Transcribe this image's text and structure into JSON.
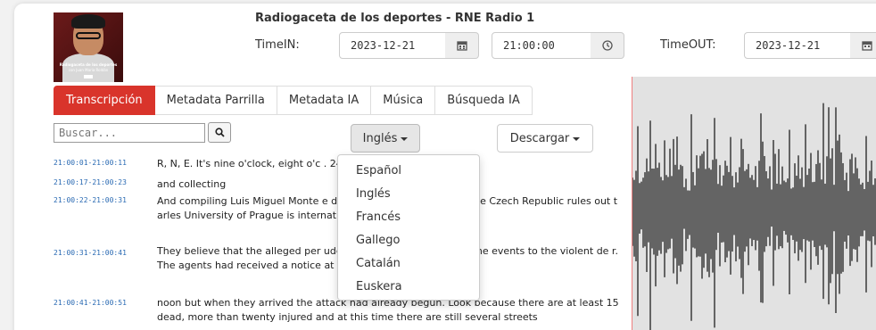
{
  "program": {
    "title": "Radiogaceta de los deportes - RNE Radio 1",
    "cover_caption_1": "Radiogaceta de los deportes",
    "cover_caption_2": "con Juan Maria Roldán"
  },
  "time_in": {
    "label": "TimeIN:",
    "date": "2023-12-21",
    "time": "21:00:00"
  },
  "time_out": {
    "label": "TimeOUT:",
    "date": "2023-12-21"
  },
  "tabs": [
    {
      "label": "Transcripción",
      "active": true
    },
    {
      "label": "Metadata Parrilla",
      "active": false
    },
    {
      "label": "Metadata IA",
      "active": false
    },
    {
      "label": "Música",
      "active": false
    },
    {
      "label": "Búsqueda IA",
      "active": false
    }
  ],
  "search": {
    "placeholder": "Buscar..."
  },
  "language_button": {
    "label": "Inglés"
  },
  "download_button": {
    "label": "Descargar"
  },
  "language_menu": [
    "Español",
    "Inglés",
    "Francés",
    "Gallego",
    "Catalán",
    "Euskera"
  ],
  "transcript": [
    {
      "time": "21:00:01-21:00:11",
      "text": "R, N, E. It's nine o'clock, eight o'c                              . 24"
    },
    {
      "time": "21:00:17-21:00:23",
      "text": "and collecting"
    },
    {
      "time": "21:00:22-21:00:31",
      "text": "And compiling Luis Miguel Monte                           e day that the government of the Czech Republic rules out t                              arles University of Prague is international terrorism."
    },
    {
      "time": "21:00:31-21:00:41",
      "text": "They believe that the alleged per                              udent, acted alone and relate the events to the violent de                               r. The agents had received a notice at"
    },
    {
      "time": "21:00:41-21:00:51",
      "text": "noon but when they arrived the attack had already begun. Look because there are at least 15 dead, more than twenty injured and at this time there are still several streets"
    }
  ],
  "colors": {
    "accent": "#d9342b",
    "timestamp": "#2a6ab3",
    "waveform": "#111111"
  }
}
